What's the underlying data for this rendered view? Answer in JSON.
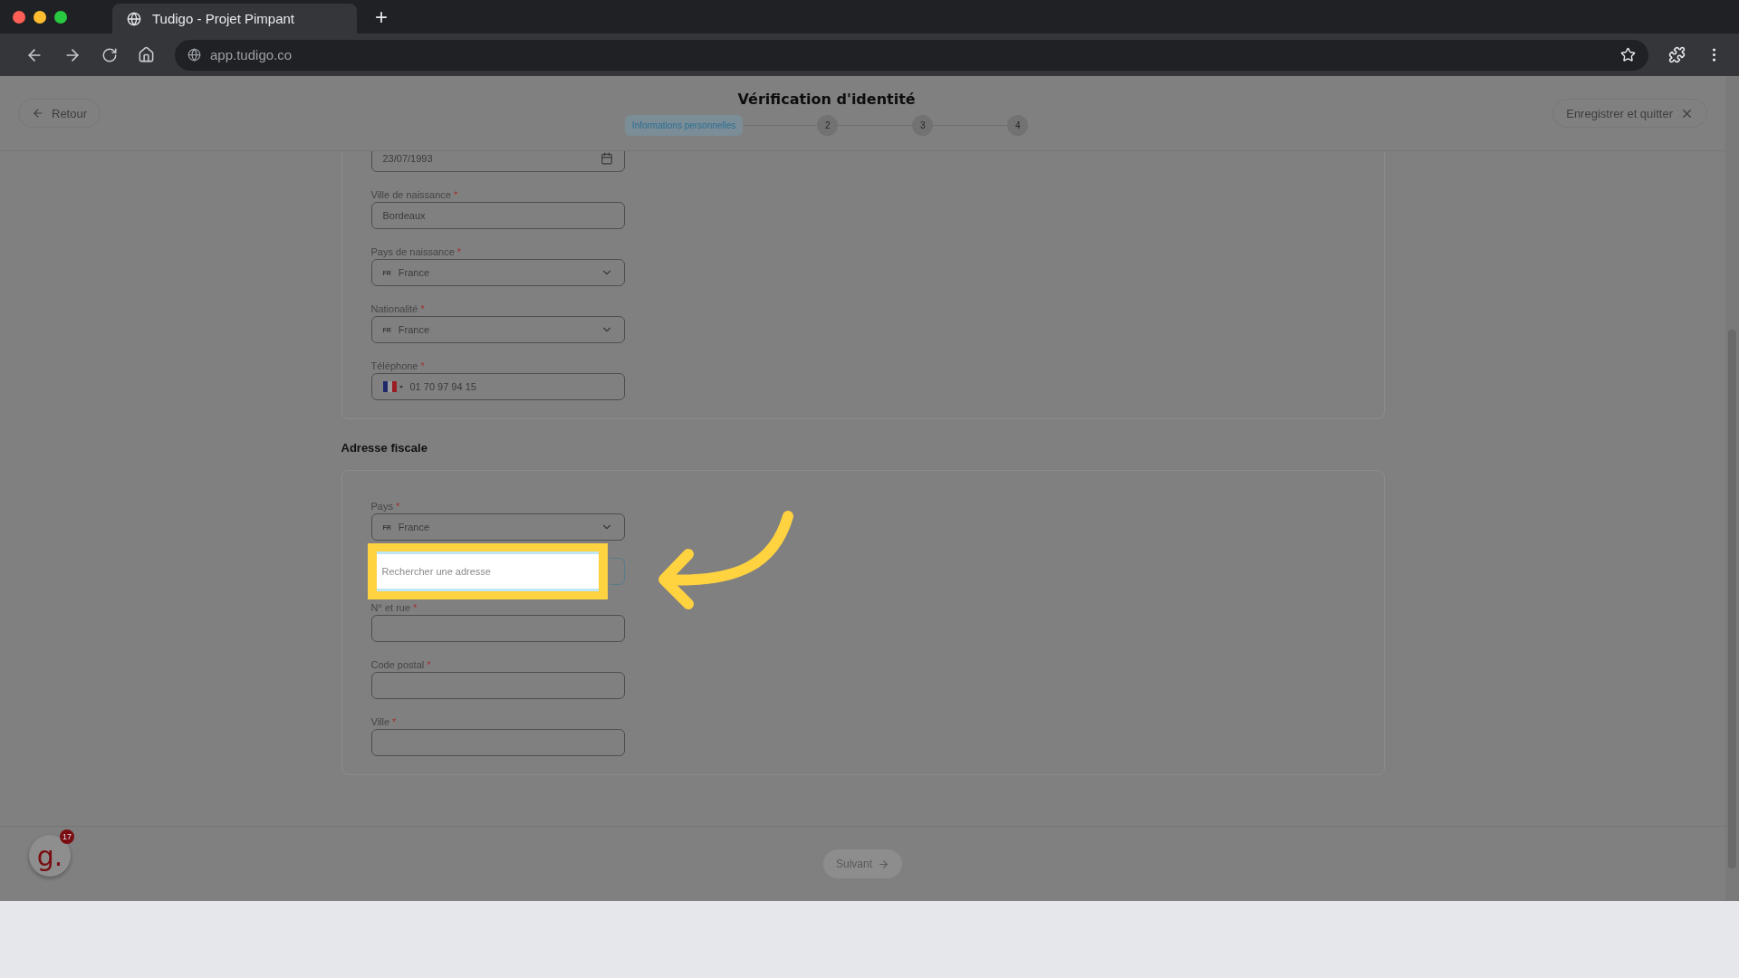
{
  "browser": {
    "tab_title": "Tudigo - Projet Pimpant",
    "new_tab": "+",
    "url": "app.tudigo.co"
  },
  "header": {
    "back": "Retour",
    "title": "Vérification d'identité",
    "save": "Enregistrer et quitter",
    "steps": [
      {
        "label": "Informations personnelles",
        "selected": true
      },
      {
        "label": "2",
        "selected": false
      },
      {
        "label": "3",
        "selected": false
      },
      {
        "label": "4",
        "selected": false
      }
    ]
  },
  "identity_fields": [
    {
      "kind": "date",
      "value": "23/07/1993"
    },
    {
      "kind": "text",
      "label": "Ville de naissance",
      "mark": "*",
      "value": "Bordeaux"
    },
    {
      "kind": "select",
      "label": "Pays de naissance",
      "mark": "*",
      "code": "FR",
      "value": "France"
    },
    {
      "kind": "select",
      "label": "Nationalité",
      "mark": "*",
      "code": "FR",
      "value": "France"
    },
    {
      "kind": "phone",
      "label": "Téléphone",
      "mark": "*",
      "value": "01 70 97 94 15"
    }
  ],
  "address_title": "Adresse fiscale",
  "address_fields": [
    {
      "kind": "select",
      "label": "Pays",
      "mark": "*",
      "code": "FR",
      "value": "France"
    },
    {
      "kind": "search",
      "placeholder": "Rechercher une adresse"
    },
    {
      "kind": "text",
      "label": "N° et rue",
      "mark": "*"
    },
    {
      "kind": "text",
      "label": "Code postal",
      "mark": "*"
    },
    {
      "kind": "text",
      "label": "Ville",
      "mark": "*"
    }
  ],
  "footer": {
    "next": "Suivant"
  },
  "launcher": {
    "logo": "g.",
    "badge": "17"
  }
}
